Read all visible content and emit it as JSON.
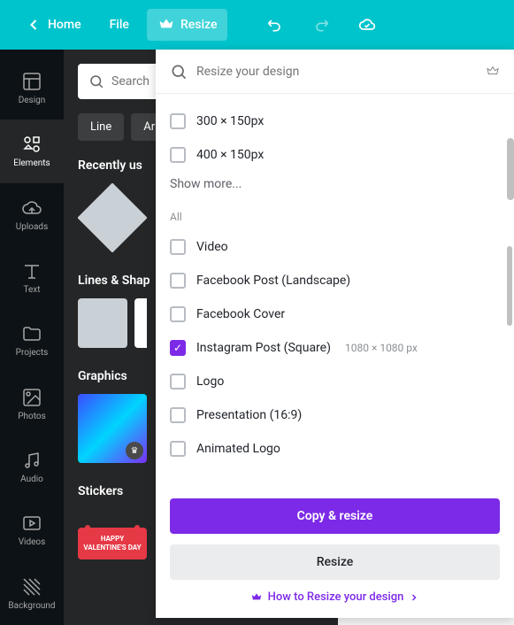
{
  "topbar": {
    "home": "Home",
    "file": "File",
    "resize": "Resize"
  },
  "sidebar": {
    "items": [
      {
        "label": "Design"
      },
      {
        "label": "Elements"
      },
      {
        "label": "Uploads"
      },
      {
        "label": "Text"
      },
      {
        "label": "Projects"
      },
      {
        "label": "Photos"
      },
      {
        "label": "Audio"
      },
      {
        "label": "Videos"
      },
      {
        "label": "Background"
      }
    ]
  },
  "panel": {
    "search_placeholder": "Search",
    "chips": [
      "Line",
      "Arr"
    ],
    "sections": {
      "recent": "Recently us",
      "lines": "Lines & Shap",
      "graphics": "Graphics",
      "stickers": "Stickers"
    },
    "sticker_text": "HAPPY VALENTINE'S DAY"
  },
  "resize": {
    "search_placeholder": "Resize your design",
    "quick": [
      {
        "label": "300 × 150px"
      },
      {
        "label": "400 × 150px"
      }
    ],
    "showmore": "Show more...",
    "all_label": "All",
    "options": [
      {
        "label": "Video",
        "checked": false
      },
      {
        "label": "Facebook Post (Landscape)",
        "checked": false
      },
      {
        "label": "Facebook Cover",
        "checked": false
      },
      {
        "label": "Instagram Post (Square)",
        "checked": true,
        "dims": "1080 × 1080 px"
      },
      {
        "label": "Logo",
        "checked": false
      },
      {
        "label": "Presentation (16:9)",
        "checked": false
      },
      {
        "label": "Animated Logo",
        "checked": false
      }
    ],
    "copy_btn": "Copy & resize",
    "resize_btn": "Resize",
    "howto": "How to Resize your design"
  }
}
